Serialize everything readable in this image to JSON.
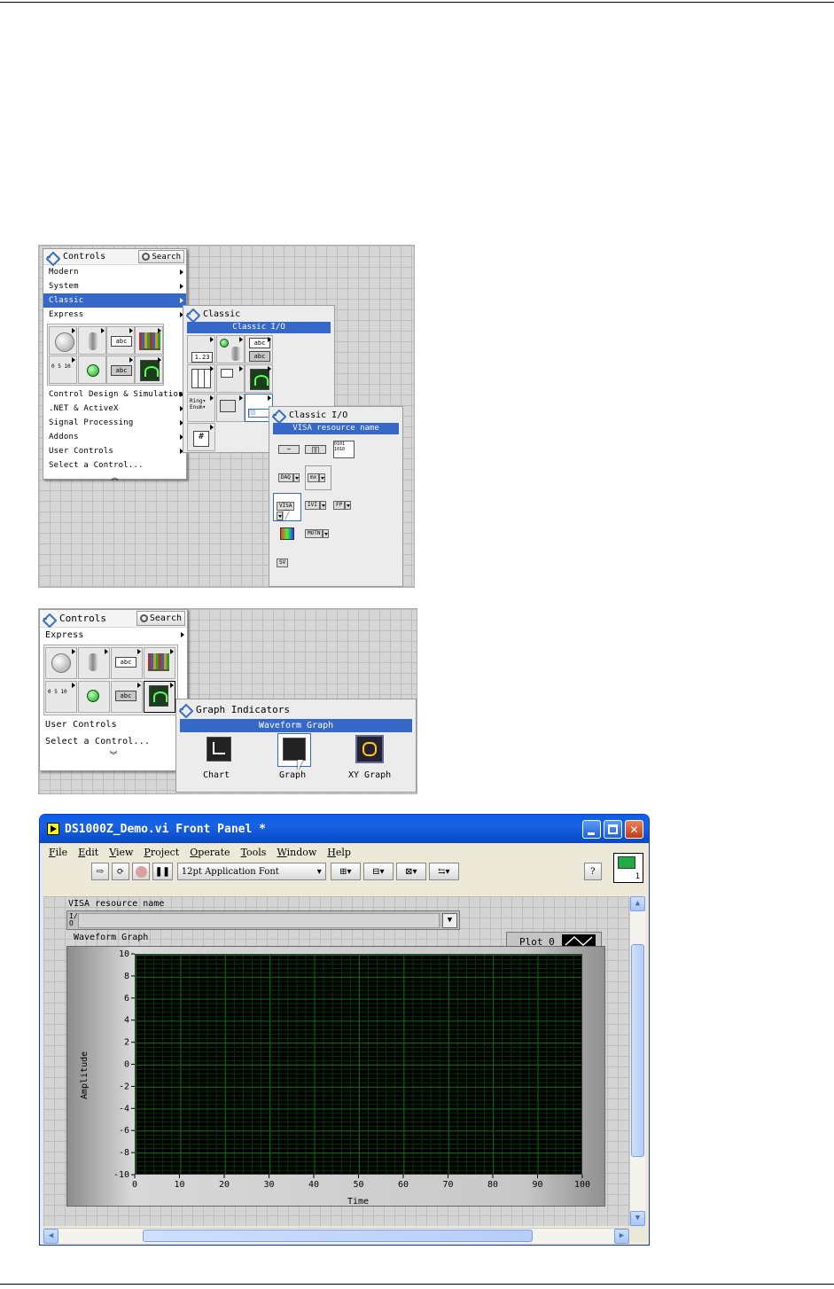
{
  "screenshot1": {
    "controls_palette": {
      "title": "Controls",
      "search_label": "Search",
      "items_top": [
        "Modern",
        "System",
        "Classic",
        "Express"
      ],
      "selected_item": "Classic",
      "items_bottom": [
        "Control Design & Simulation",
        ".NET & ActiveX",
        "Signal Processing",
        "Addons",
        "User Controls",
        "Select a Control..."
      ]
    },
    "classic_palette": {
      "title": "Classic",
      "highlight": "Classic I/O"
    },
    "classic_io_palette": {
      "title": "Classic I/O",
      "highlight": "VISA resource name",
      "buttons": [
        "DAQ",
        "mx",
        "VISA",
        "IVI",
        "FP",
        "MOTN",
        "SV"
      ]
    }
  },
  "screenshot2": {
    "controls_palette": {
      "title": "Controls",
      "search_label": "Search",
      "express_label": "Express",
      "items_bottom": [
        "User Controls",
        "Select a Control..."
      ]
    },
    "graph_indicators": {
      "title": "Graph Indicators",
      "highlight": "Waveform Graph",
      "items": [
        "Chart",
        "Graph",
        "XY Graph"
      ]
    }
  },
  "front_panel": {
    "title": "DS1000Z_Demo.vi Front Panel *",
    "menu": [
      "File",
      "Edit",
      "View",
      "Project",
      "Operate",
      "Tools",
      "Window",
      "Help"
    ],
    "font_select": "12pt Application Font",
    "visa_label": "VISA resource name",
    "io_prefix": "I/O",
    "graph_label": "Waveform Graph",
    "legend_label": "Plot 0",
    "icon_number": "1",
    "colors": {
      "plot_bg": "#000000",
      "grid": "#0f6a0f",
      "titlebar": "#0a5fe8"
    }
  },
  "chart_data": {
    "type": "line",
    "title": "",
    "xlabel": "Time",
    "ylabel": "Amplitude",
    "xlim": [
      0,
      100
    ],
    "ylim": [
      -10,
      10
    ],
    "x_ticks": [
      0,
      10,
      20,
      30,
      40,
      50,
      60,
      70,
      80,
      90,
      100
    ],
    "y_ticks": [
      10,
      8,
      6,
      4,
      2,
      0,
      -2,
      -4,
      -6,
      -8,
      -10
    ],
    "y_tick_labels": [
      "10",
      "8",
      "6",
      "4",
      "2",
      "0",
      "-2",
      "-4",
      "-6",
      "-8",
      "-10"
    ],
    "grid": true,
    "series": [
      {
        "name": "Plot 0",
        "values": []
      }
    ]
  }
}
